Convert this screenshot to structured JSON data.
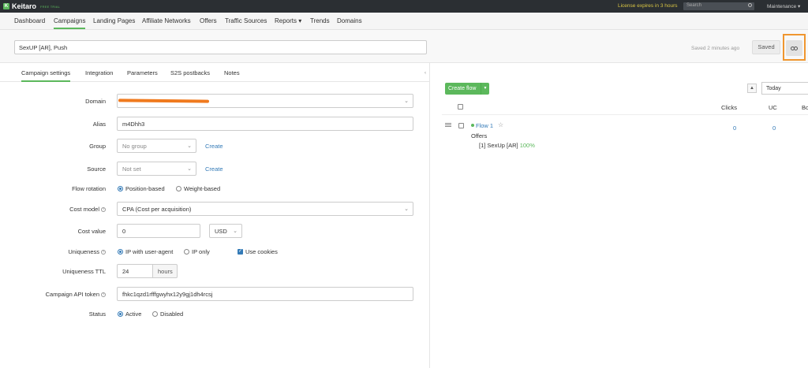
{
  "topbar": {
    "logo_text": "Keitaro",
    "logo_badge": "FREE TRIAL",
    "license_notice": "License expires in 3 hours",
    "search_placeholder": "Search",
    "maintenance": "Maintenance ▾"
  },
  "nav": {
    "items": [
      "Dashboard",
      "Campaigns",
      "Landing Pages",
      "Affiliate Networks",
      "Offers",
      "Traffic Sources",
      "Reports ▾",
      "Trends",
      "Domains"
    ],
    "active": "Campaigns"
  },
  "header": {
    "campaign_name": "SexUP [AR], Push",
    "saved_ago": "Saved 2 minutes ago",
    "saved_label": "Saved",
    "link_icon": "link-icon",
    "highlight_color": "#f0962f"
  },
  "tabs": {
    "items": [
      "Campaign settings",
      "Integration",
      "Parameters",
      "S2S postbacks",
      "Notes"
    ],
    "active": "Campaign settings"
  },
  "form": {
    "domain_label": "Domain",
    "alias_label": "Alias",
    "alias_value": "m4Dhh3",
    "group_label": "Group",
    "group_value": "No group",
    "create_label": "Create",
    "source_label": "Source",
    "source_value": "Not set",
    "flow_rotation_label": "Flow rotation",
    "position_based": "Position-based",
    "weight_based": "Weight-based",
    "cost_model_label": "Cost model",
    "cost_model_value": "CPA (Cost per acquisition)",
    "cost_value_label": "Cost value",
    "cost_value": "0",
    "currency": "USD",
    "uniqueness_label": "Uniqueness",
    "ip_ua": "IP with user-agent",
    "ip_only": "IP only",
    "use_cookies": "Use cookies",
    "ttl_label": "Uniqueness TTL",
    "ttl_value": "24",
    "ttl_unit": "hours",
    "api_token_label": "Campaign API token",
    "api_token_value": "fhkc1qzd1rfffgwyhx12y9gj1dh4rcsj",
    "status_label": "Status",
    "active": "Active",
    "disabled": "Disabled"
  },
  "flows": {
    "create_flow": "Create flow",
    "date_range": "Today",
    "col_clicks": "Clicks",
    "col_uc": "UC",
    "col_partial": "Bo",
    "flow_name": "Flow 1",
    "offers_label": "Offers",
    "offer_entry": "[1] SexUp [AR]",
    "offer_share": "100%",
    "clicks": "0",
    "uc": "0",
    "accent_color": "#5cb85c"
  }
}
